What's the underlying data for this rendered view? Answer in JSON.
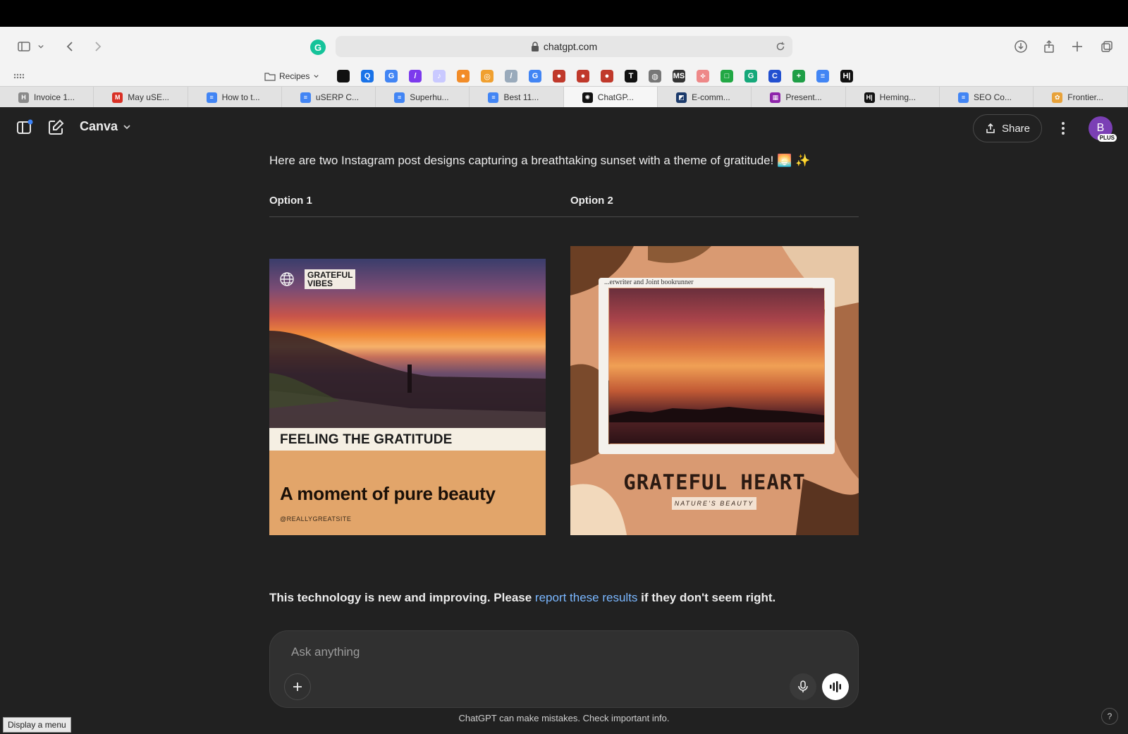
{
  "browser": {
    "url": "chatgpt.com",
    "bookmarks": {
      "folder_label": "Recipes",
      "items": [
        {
          "icon": "apple-icon",
          "glyph": "",
          "color": "#111111"
        },
        {
          "icon": "search-icon",
          "glyph": "Q",
          "color": "#1a73e8"
        },
        {
          "icon": "google-icon",
          "glyph": "G",
          "color": "#4285f4"
        },
        {
          "icon": "pen-icon",
          "glyph": "/",
          "color": "#7c3aed"
        },
        {
          "icon": "tiktok-icon",
          "glyph": "♪",
          "color": "#c9c9ff"
        },
        {
          "icon": "orange-icon",
          "glyph": "●",
          "color": "#f28c28"
        },
        {
          "icon": "planet-icon",
          "glyph": "◎",
          "color": "#f0a030"
        },
        {
          "icon": "feather-icon",
          "glyph": "/",
          "color": "#9ab"
        },
        {
          "icon": "google-icon",
          "glyph": "G",
          "color": "#4285f4"
        },
        {
          "icon": "flag-icon",
          "glyph": "●",
          "color": "#c0392b"
        },
        {
          "icon": "flag-icon",
          "glyph": "●",
          "color": "#c0392b"
        },
        {
          "icon": "flag-icon",
          "glyph": "●",
          "color": "#c0392b"
        },
        {
          "icon": "t-icon",
          "glyph": "T",
          "color": "#111111"
        },
        {
          "icon": "globe-icon",
          "glyph": "◍",
          "color": "#777777"
        },
        {
          "icon": "ms-icon",
          "glyph": "MS",
          "color": "#333333"
        },
        {
          "icon": "figure-icon",
          "glyph": "⟡",
          "color": "#e88"
        },
        {
          "icon": "green-square-icon",
          "glyph": "□",
          "color": "#22a845"
        },
        {
          "icon": "grammarly-icon",
          "glyph": "G",
          "color": "#15a87a"
        },
        {
          "icon": "c-icon",
          "glyph": "C",
          "color": "#2250d0"
        },
        {
          "icon": "plus-square-icon",
          "glyph": "+",
          "color": "#1e9e46"
        },
        {
          "icon": "docs-icon",
          "glyph": "≡",
          "color": "#4285f4"
        },
        {
          "icon": "hemingway-icon",
          "glyph": "H|",
          "color": "#111111"
        }
      ]
    },
    "tabs": [
      {
        "label": "Invoice 1...",
        "icon": "h-icon",
        "glyph": "H",
        "color": "#8a8a8a",
        "active": false
      },
      {
        "label": "May uSE...",
        "icon": "gmail-icon",
        "glyph": "M",
        "color": "#d93025",
        "active": false
      },
      {
        "label": "How to t...",
        "icon": "docs-icon",
        "glyph": "≡",
        "color": "#4285f4",
        "active": false
      },
      {
        "label": "uSERP C...",
        "icon": "docs-icon",
        "glyph": "≡",
        "color": "#4285f4",
        "active": false
      },
      {
        "label": "Superhu...",
        "icon": "docs-icon",
        "glyph": "≡",
        "color": "#4285f4",
        "active": false
      },
      {
        "label": "Best 11...",
        "icon": "docs-icon",
        "glyph": "≡",
        "color": "#4285f4",
        "active": false
      },
      {
        "label": "ChatGP...",
        "icon": "openai-icon",
        "glyph": "✺",
        "color": "#111111",
        "active": true
      },
      {
        "label": "E-comm...",
        "icon": "e-icon",
        "glyph": "◩",
        "color": "#1b3a6b",
        "active": false
      },
      {
        "label": "Present...",
        "icon": "slides-icon",
        "glyph": "▦",
        "color": "#8e24aa",
        "active": false
      },
      {
        "label": "Heming...",
        "icon": "hemingway-icon",
        "glyph": "H|",
        "color": "#111111",
        "active": false
      },
      {
        "label": "SEO Co...",
        "icon": "docs-icon",
        "glyph": "≡",
        "color": "#4285f4",
        "active": false
      },
      {
        "label": "Frontier...",
        "icon": "frontier-icon",
        "glyph": "✿",
        "color": "#e8a23a",
        "active": false
      }
    ]
  },
  "app": {
    "model_name": "Canva",
    "share_label": "Share",
    "avatar_letter": "B",
    "avatar_badge": "PLUS",
    "intro_text": "Here are two Instagram post designs capturing a breathtaking sunset with a theme of gratitude! 🌅 ✨",
    "options": [
      {
        "header": "Option 1",
        "badge_line1": "GRATEFUL",
        "badge_line2": "VIBES",
        "band_text": "FEELING THE GRATITUDE",
        "headline": "A moment of pure beauty",
        "handle": "@REALLYGREATSITE"
      },
      {
        "header": "Option 2",
        "paper_text": "...erwriter and Joint bookrunner",
        "title": "GRATEFUL HEART",
        "subtitle": "NATURE'S BEAUTY"
      }
    ],
    "disclaimer_before": "This technology is new and improving. Please ",
    "disclaimer_link": "report these results",
    "disclaimer_after": " if they don't seem right.",
    "composer_placeholder": "Ask anything",
    "footnote": "ChatGPT can make mistakes. Check important info.",
    "help_label": "?",
    "tooltip": "Display a menu"
  },
  "colors": {
    "app_bg": "#212121",
    "composer_bg": "#303030",
    "link": "#7ab7ff",
    "avatar": "#7b3fb5"
  }
}
